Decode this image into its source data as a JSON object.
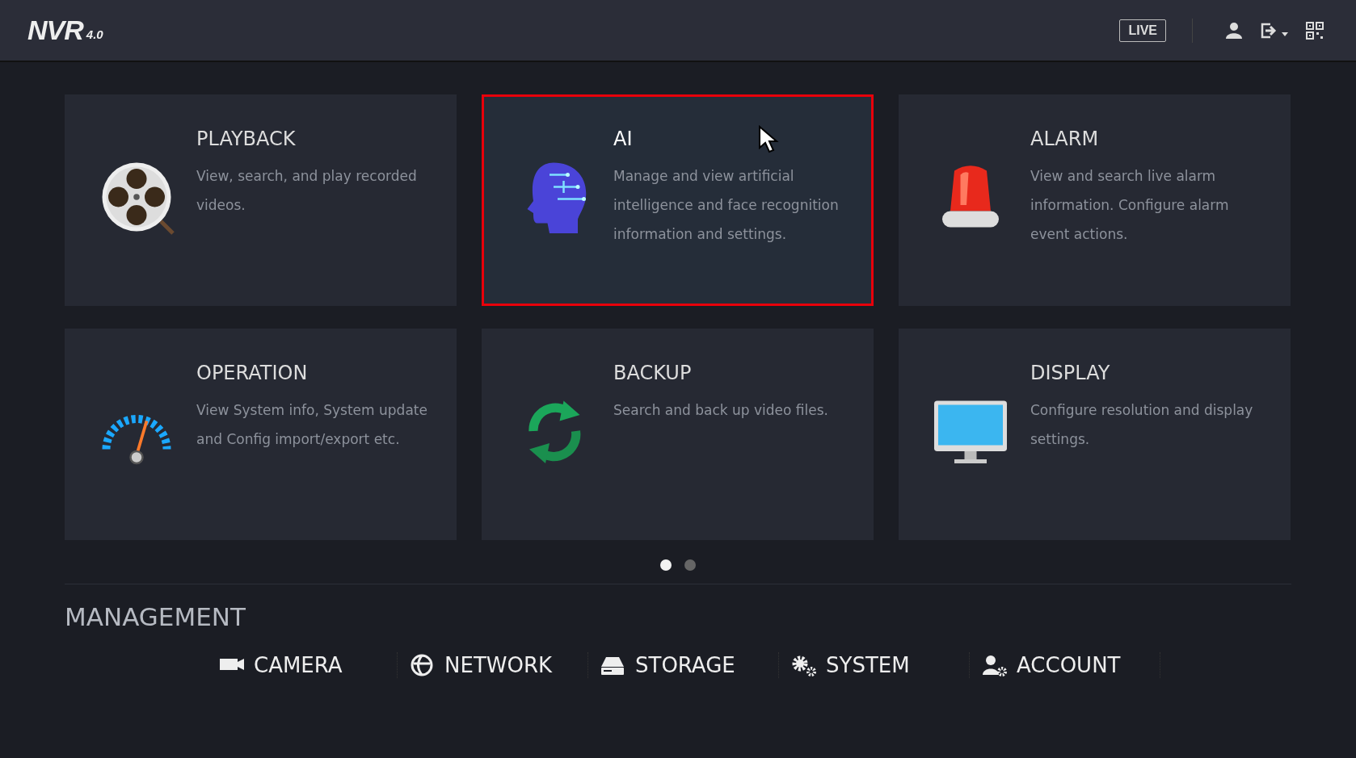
{
  "header": {
    "logo": "NVR",
    "logo_version": "4.0",
    "live_button": "LIVE"
  },
  "cards": [
    {
      "title": "PLAYBACK",
      "description": "View, search, and play recorded videos.",
      "selected": false
    },
    {
      "title": "AI",
      "description": "Manage and view artificial intelligence and face recognition information and settings.",
      "selected": true
    },
    {
      "title": "ALARM",
      "description": "View and search live alarm information. Configure alarm event actions.",
      "selected": false
    },
    {
      "title": "OPERATION",
      "description": "View System info, System update and Config import/export etc.",
      "selected": false
    },
    {
      "title": "BACKUP",
      "description": "Search and back up video files.",
      "selected": false
    },
    {
      "title": "DISPLAY",
      "description": "Configure resolution and display settings.",
      "selected": false
    }
  ],
  "pages": [
    {
      "selected": true
    },
    {
      "selected": false
    }
  ],
  "management": {
    "title": "MANAGEMENT",
    "items": [
      {
        "label": "CAMERA"
      },
      {
        "label": "NETWORK"
      },
      {
        "label": "STORAGE"
      },
      {
        "label": "SYSTEM"
      },
      {
        "label": "ACCOUNT"
      }
    ]
  }
}
